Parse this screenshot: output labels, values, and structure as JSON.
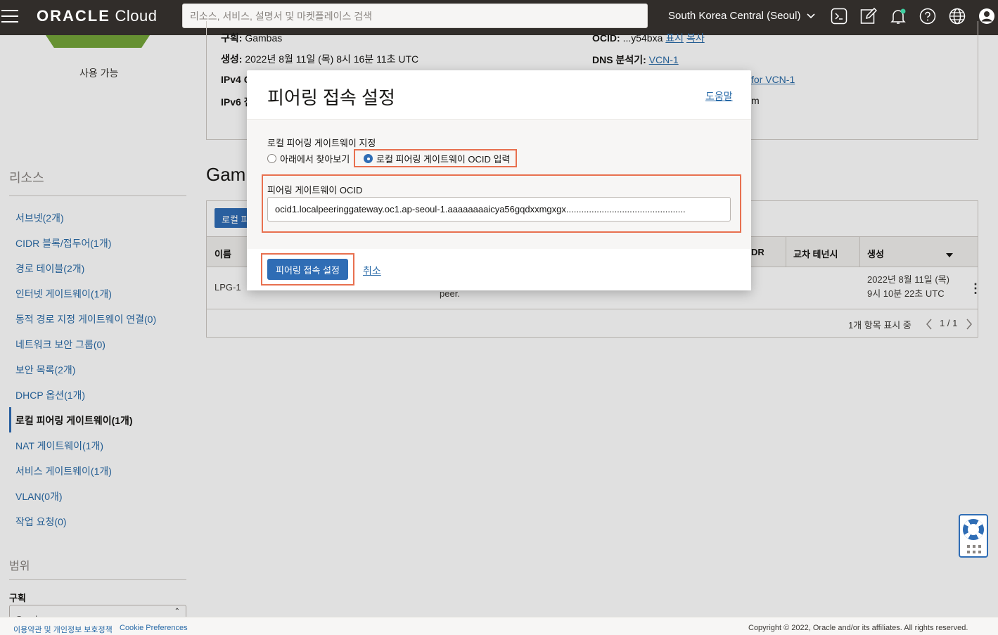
{
  "header": {
    "logo_brand": "ORACLE",
    "logo_product": "Cloud",
    "search_placeholder": "리소스, 서비스, 설명서 및 마켓플레이스 검색",
    "region": "South Korea Central (Seoul)"
  },
  "sidebar": {
    "status_label": "사용 가능",
    "resources_title": "리소스",
    "items": [
      {
        "label": "서브넷(2개)"
      },
      {
        "label": "CIDR 블록/접두어(1개)"
      },
      {
        "label": "경로 테이블(2개)"
      },
      {
        "label": "인터넷 게이트웨이(1개)"
      },
      {
        "label": "동적 경로 지정 게이트웨이 연결(0)"
      },
      {
        "label": "네트워크 보안 그룹(0)"
      },
      {
        "label": "보안 목록(2개)"
      },
      {
        "label": "DHCP 옵션(1개)"
      },
      {
        "label": "로컬 피어링 게이트웨이(1개)"
      },
      {
        "label": "NAT 게이트웨이(1개)"
      },
      {
        "label": "서비스 게이트웨이(1개)"
      },
      {
        "label": "VLAN(0개)"
      },
      {
        "label": "작업 요청(0)"
      }
    ],
    "scope_title": "범위",
    "compartment_label": "구획",
    "compartment_value": "Gambas"
  },
  "details": {
    "compartment_key": "구획:",
    "compartment_val": "Gambas",
    "created_key": "생성:",
    "created_val": "2022년 8월 11일 (목) 8시 16분 11초 UTC",
    "ipv4_key": "IPv4 C",
    "ipv6_key": "IPv6 접",
    "ocid_key": "OCID:",
    "ocid_val": "...y54bxa",
    "ocid_show": "표시",
    "ocid_copy": "복사",
    "dns_key": "DNS 분석기:",
    "dns_val": "VCN-1",
    "default_route_link": "for VCN-1",
    "trailing_m": "m"
  },
  "section_title": "Gam",
  "table": {
    "create_button": "로컬 피",
    "headers": {
      "name": "이름",
      "cidr": "DR",
      "cross_tenancy": "교차 테넌시",
      "created": "생성"
    },
    "rows": [
      {
        "name": "LPG-1",
        "peer_text": "peer.",
        "created_line1": "2022년 8월 11일 (목)",
        "created_line2": "9시 10분 22초 UTC"
      }
    ],
    "pager_text": "1개 항목 표시 중",
    "pager_pages": "1 / 1"
  },
  "dialog": {
    "title": "피어링 접속 설정",
    "help_link": "도움말",
    "section_label": "로컬 피어링 게이트웨이 지정",
    "radio_browse": "아래에서 찾아보기",
    "radio_ocid": "로컬 피어링 게이트웨이 OCID 입력",
    "selected_option": "radio_ocid",
    "field_label": "피어링 게이트웨이 OCID",
    "field_value": "ocid1.localpeeringgateway.oc1.ap-seoul-1.aaaaaaaaicya56gqdxxmgxgx...............................................",
    "primary_button": "피어링 접속 설정",
    "cancel_link": "취소"
  },
  "footer": {
    "terms": "이용약관 및 개인정보 보호정책",
    "cookie": "Cookie Preferences",
    "copyright": "Copyright © 2022, Oracle and/or its affiliates. All rights reserved."
  },
  "colors": {
    "topbar": "#312d2a",
    "primary": "#2f6db5",
    "link": "#2a6ba8",
    "highlight": "#e8704f",
    "status_green": "#75a53a"
  }
}
